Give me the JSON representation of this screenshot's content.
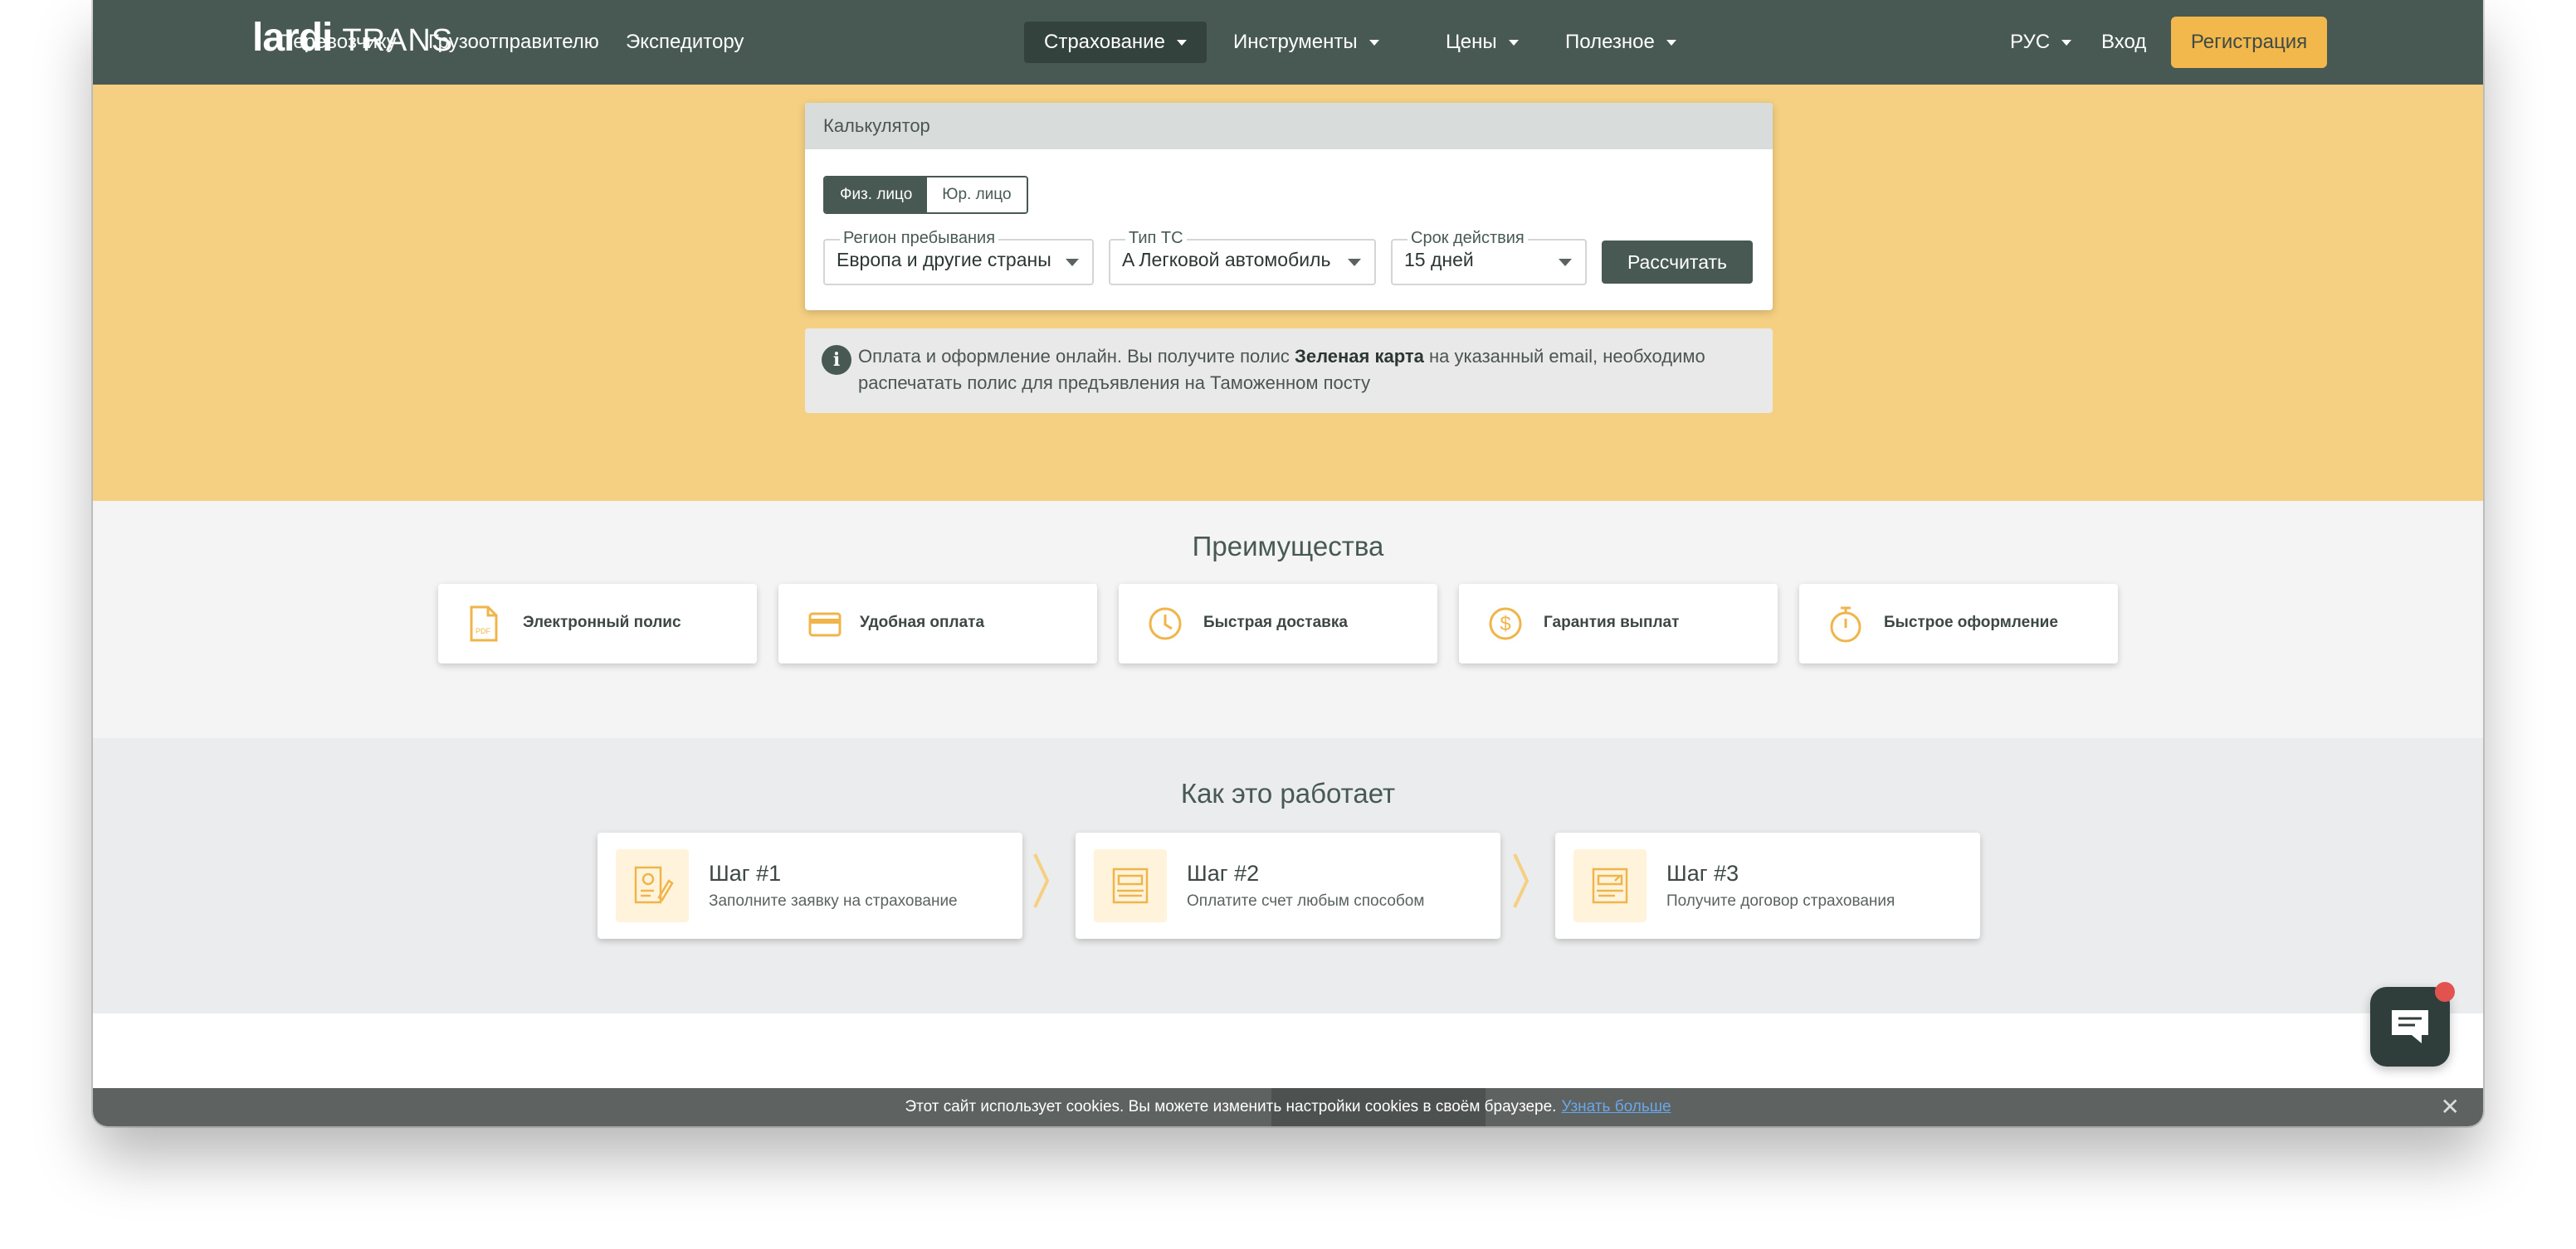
{
  "header": {
    "logo_bold": "lardi",
    "logo_rest": "TRANS",
    "nav": [
      {
        "label": "Перевозчику",
        "has_caret": false,
        "active": false
      },
      {
        "label": "Грузоотправителю",
        "has_caret": false,
        "active": false
      },
      {
        "label": "Экспедитору",
        "has_caret": false,
        "active": false
      },
      {
        "label": "Страхование",
        "has_caret": true,
        "active": true
      },
      {
        "label": "Инструменты",
        "has_caret": true,
        "active": false
      },
      {
        "label": "Цены",
        "has_caret": true,
        "active": false
      },
      {
        "label": "Полезное",
        "has_caret": true,
        "active": false
      }
    ],
    "lang": "РУС",
    "login": "Вход",
    "register": "Регистрация"
  },
  "calculator": {
    "title": "Калькулятор",
    "person_types": [
      "Физ. лицо",
      "Юр. лицо"
    ],
    "selected_person_type": "Физ. лицо",
    "fields": [
      {
        "label": "Регион пребывания",
        "value": "Европа и другие страны"
      },
      {
        "label": "Тип ТС",
        "value": "A Легковой автомобиль"
      },
      {
        "label": "Срок действия",
        "value": "15 дней"
      }
    ],
    "submit": "Рассчитать"
  },
  "info": {
    "before": "Оплата и оформление онлайн. Вы получите полис ",
    "bold": "Зеленая карта",
    "after": " на указанный email, необходимо распечатать полис для предъявления на Таможенном посту"
  },
  "advantages": {
    "title": "Преимущества",
    "items": [
      {
        "label": "Электронный полис",
        "icon": "pdf-icon"
      },
      {
        "label": "Удобная оплата",
        "icon": "credit-card-icon"
      },
      {
        "label": "Быстрая доставка",
        "icon": "clock-icon"
      },
      {
        "label": "Гарантия выплат",
        "icon": "dollar-icon"
      },
      {
        "label": "Быстрое оформление",
        "icon": "stopwatch-icon"
      }
    ]
  },
  "how": {
    "title": "Как это работает",
    "steps": [
      {
        "title": "Шаг #1",
        "desc": "Заполните заявку на страхование",
        "icon": "application-form-icon"
      },
      {
        "title": "Шаг #2",
        "desc": "Оплатите счет любым способом",
        "icon": "payment-terminal-icon"
      },
      {
        "title": "Шаг #3",
        "desc": "Получите договор страхования",
        "icon": "contract-icon"
      }
    ]
  },
  "cookie": {
    "text": "Этот сайт использует cookies. Вы можете изменить настройки cookies в своём браузере.",
    "link": "Узнать больше"
  },
  "colors": {
    "header_bg": "#485954",
    "accent": "#f2b84b",
    "hero_bg": "#f5d082",
    "icon_orange": "#f0b54a"
  }
}
